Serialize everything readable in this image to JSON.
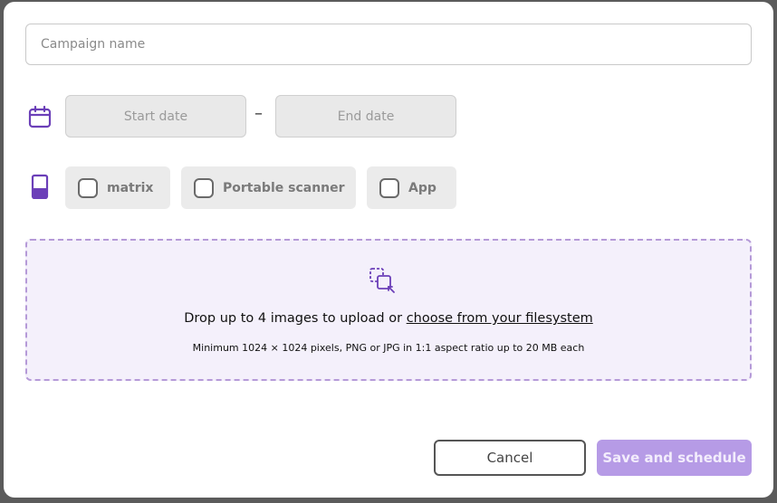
{
  "form": {
    "campaign_name": {
      "placeholder": "Campaign name",
      "value": ""
    },
    "dates": {
      "start_placeholder": "Start date",
      "end_placeholder": "End date",
      "separator": "–",
      "icon": "calendar-icon"
    },
    "devices": {
      "icon": "phone-icon",
      "options": [
        {
          "label": "matrix",
          "checked": false
        },
        {
          "label": "Portable scanner",
          "checked": false
        },
        {
          "label": "App",
          "checked": false
        }
      ]
    },
    "upload": {
      "icon": "upload-images-icon",
      "main_text": "Drop up to 4 images to upload or ",
      "link_text": "choose from your filesystem",
      "hint": "Minimum 1024 × 1024 pixels, PNG or JPG in 1:1 aspect ratio up to 20 MB each"
    }
  },
  "actions": {
    "cancel_label": "Cancel",
    "save_label": "Save and schedule"
  },
  "colors": {
    "accent": "#6b3fb8",
    "save_button_bg": "#b69be6",
    "dropzone_bg": "#f4f0fb",
    "dropzone_border": "#b59ad8"
  }
}
